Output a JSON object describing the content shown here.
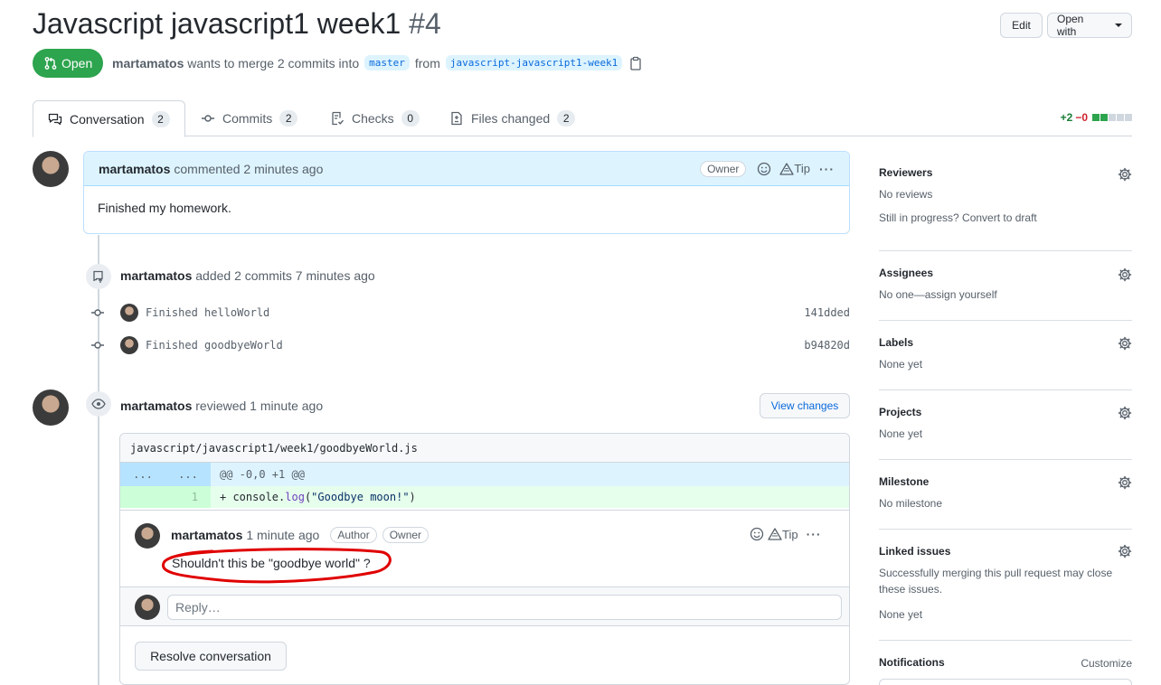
{
  "header": {
    "title": "Javascript javascript1 week1",
    "number": "#4",
    "edit_label": "Edit",
    "open_with_label": "Open with",
    "state_label": "Open",
    "author": "martamatos",
    "merge_text": "wants to merge 2 commits into",
    "base_branch": "master",
    "from_text": "from",
    "head_branch": "javascript-javascript1-week1"
  },
  "tabs": [
    {
      "label": "Conversation",
      "count": "2",
      "icon": "comment-discussion-icon"
    },
    {
      "label": "Commits",
      "count": "2",
      "icon": "git-commit-icon"
    },
    {
      "label": "Checks",
      "count": "0",
      "icon": "checklist-icon"
    },
    {
      "label": "Files changed",
      "count": "2",
      "icon": "file-diff-icon"
    }
  ],
  "diffstat": {
    "additions": "+2",
    "deletions": "−0"
  },
  "timeline": {
    "comment": {
      "author": "martamatos",
      "action": "commented 2 minutes ago",
      "badge": "Owner",
      "tip_label": "Tip",
      "body": "Finished my homework."
    },
    "commits_event": {
      "author": "martamatos",
      "action": "added 2 commits 7 minutes ago",
      "commits": [
        {
          "message": "Finished helloWorld",
          "sha": "141dded"
        },
        {
          "message": "Finished goodbyeWorld",
          "sha": "b94820d"
        }
      ]
    },
    "review_event": {
      "author": "martamatos",
      "action": "reviewed 1 minute ago",
      "view_changes_label": "View changes",
      "file_path": "javascript/javascript1/week1/goodbyeWorld.js",
      "hunk_left": "...",
      "hunk_right": "...",
      "hunk_header": "@@ -0,0 +1 @@",
      "line_number": "1",
      "code_prefix": "+ console.",
      "code_method": "log",
      "code_open": "(",
      "code_string": "\"Goodbye moon!\"",
      "code_close": ")",
      "review_comment": {
        "author": "martamatos",
        "time": "1 minute ago",
        "badge_author": "Author",
        "badge_owner": "Owner",
        "tip_label": "Tip",
        "body": "Shouldn't this be \"goodbye world\" ?"
      },
      "reply_placeholder": "Reply…",
      "resolve_label": "Resolve conversation"
    }
  },
  "sidebar": {
    "reviewers": {
      "title": "Reviewers",
      "line1": "No reviews",
      "line2": "Still in progress? Convert to draft"
    },
    "assignees": {
      "title": "Assignees",
      "value": "No one—assign yourself"
    },
    "labels": {
      "title": "Labels",
      "value": "None yet"
    },
    "projects": {
      "title": "Projects",
      "value": "None yet"
    },
    "milestone": {
      "title": "Milestone",
      "value": "No milestone"
    },
    "linked_issues": {
      "title": "Linked issues",
      "desc": "Successfully merging this pull request may close these issues.",
      "value": "None yet"
    },
    "notifications": {
      "title": "Notifications",
      "customize": "Customize"
    }
  },
  "colors": {
    "open_green": "#2da44e",
    "annotation_red": "#e00000",
    "link_blue": "#0969da"
  }
}
